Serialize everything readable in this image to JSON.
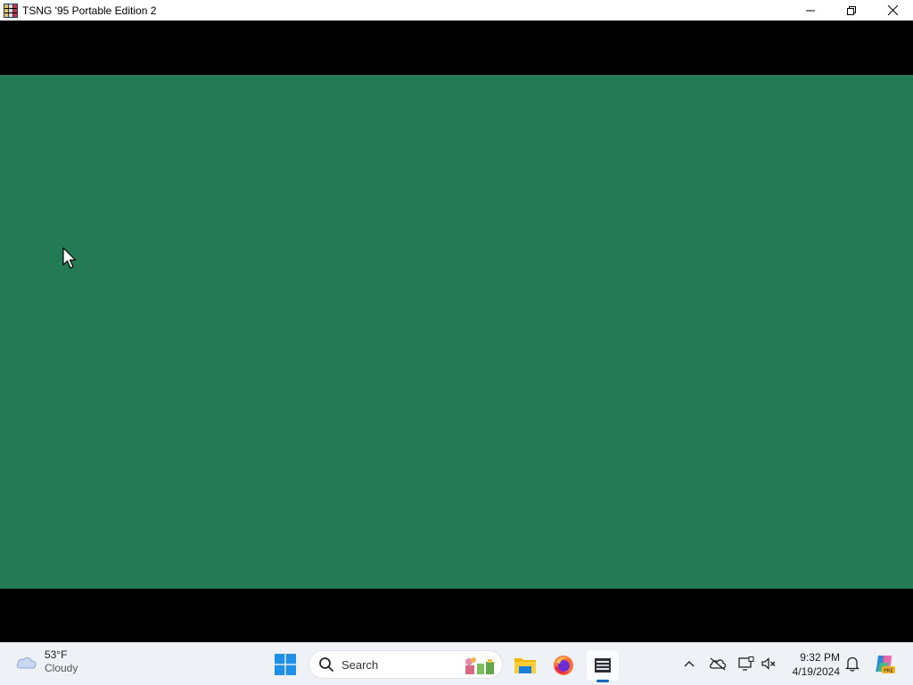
{
  "window": {
    "title": "TSNG '95 Portable Edition 2",
    "icon": "app-grid-icon",
    "controls": [
      "minimize-icon",
      "restore-icon",
      "close-icon"
    ]
  },
  "game": {
    "felt_color": "#237a55",
    "border_color": "#000000"
  },
  "taskbar": {
    "weather": {
      "temp": "53°F",
      "condition": "Cloudy",
      "icon": "cloud-icon"
    },
    "search": {
      "placeholder": "Search"
    },
    "apps": [
      {
        "name": "start",
        "icon": "windows-icon"
      },
      {
        "name": "file-explorer",
        "icon": "folder-icon"
      },
      {
        "name": "firefox",
        "icon": "firefox-icon"
      },
      {
        "name": "tsng",
        "icon": "app-grid-icon",
        "active": true
      }
    ],
    "tray": {
      "icons": [
        "chevron-up-icon",
        "onedrive-icon",
        "display-icon",
        "volume-muted-icon",
        "bell-icon",
        "copilot-icon"
      ],
      "time": "9:32 PM",
      "date": "4/19/2024"
    },
    "accent_color": "#0067c0"
  }
}
